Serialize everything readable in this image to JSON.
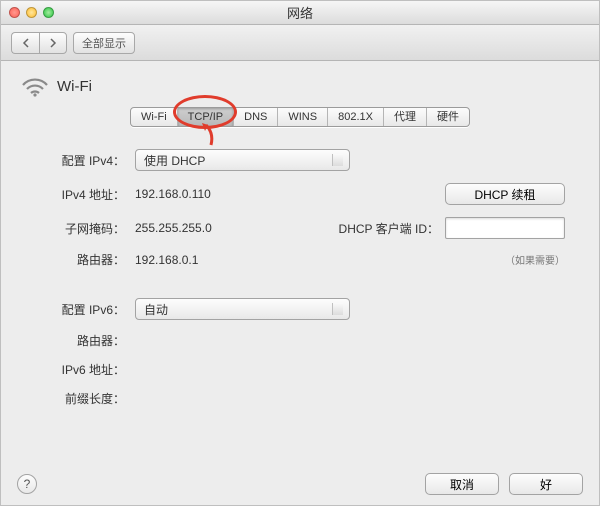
{
  "window": {
    "title": "网络"
  },
  "toolbar": {
    "show_all": "全部显示"
  },
  "header": {
    "name": "Wi-Fi"
  },
  "tabs": {
    "items": [
      "Wi-Fi",
      "TCP/IP",
      "DNS",
      "WINS",
      "802.1X",
      "代理",
      "硬件"
    ],
    "active_index": 1
  },
  "form": {
    "config_ipv4_label": "配置 IPv4：",
    "config_ipv4_value": "使用 DHCP",
    "ipv4_addr_label": "IPv4 地址：",
    "ipv4_addr_value": "192.168.0.110",
    "subnet_label": "子网掩码：",
    "subnet_value": "255.255.255.0",
    "router_label": "路由器：",
    "router_value": "192.168.0.1",
    "dhcp_renew": "DHCP 续租",
    "dhcp_client_id_label": "DHCP 客户端 ID：",
    "dhcp_hint": "（如果需要）",
    "config_ipv6_label": "配置 IPv6：",
    "config_ipv6_value": "自动",
    "router6_label": "路由器：",
    "ipv6_addr_label": "IPv6 地址：",
    "prefix_label": "前缀长度："
  },
  "footer": {
    "cancel": "取消",
    "ok": "好"
  }
}
